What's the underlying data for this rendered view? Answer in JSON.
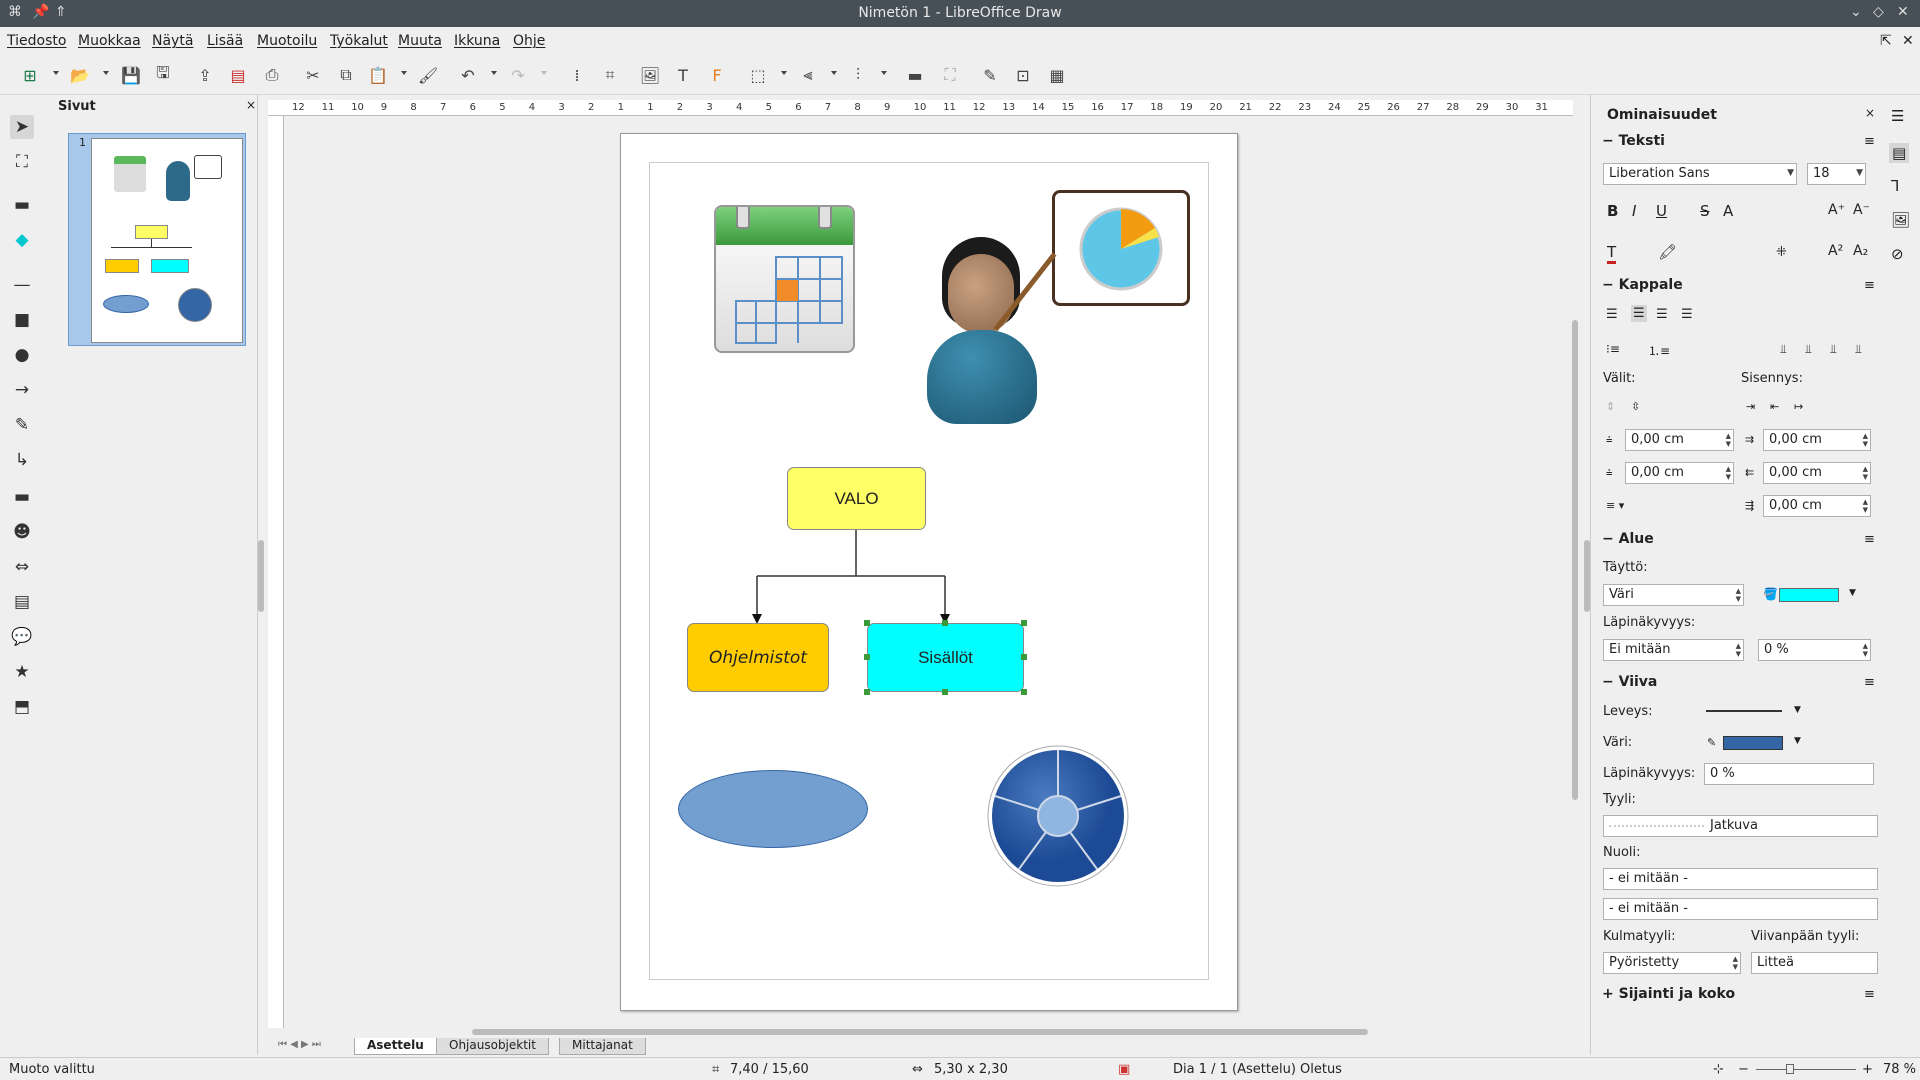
{
  "window": {
    "title": "Nimetön 1 - LibreOffice Draw"
  },
  "menu": [
    "Tiedosto",
    "Muokkaa",
    "Näytä",
    "Lisää",
    "Muotoilu",
    "Työkalut",
    "Muuta",
    "Ikkuna",
    "Ohje"
  ],
  "pages_panel": {
    "title": "Sivut",
    "page_number": "1"
  },
  "canvas": {
    "valo": "VALO",
    "ohjelmistot": "Ohjelmistot",
    "sisallot": "Sisällöt"
  },
  "sidebar": {
    "title": "Ominaisuudet",
    "text_section": "Teksti",
    "font_name": "Liberation Sans",
    "font_size": "18",
    "paragraph_section": "Kappale",
    "spacing_label": "Välit:",
    "indent_label": "Sisennys:",
    "spacing_above": "0,00 cm",
    "spacing_below": "0,00 cm",
    "indent_before": "0,00 cm",
    "indent_after": "0,00 cm",
    "indent_first": "0,00 cm",
    "area_section": "Alue",
    "fill_label": "Täyttö:",
    "fill_value": "Väri",
    "transparency_label": "Läpinäkyvyys:",
    "transparency_value": "Ei mitään",
    "transparency_percent": "0 %",
    "line_section": "Viiva",
    "width_label": "Leveys:",
    "color_label": "Väri:",
    "line_transparency_label": "Läpinäkyvyys:",
    "line_transparency_value": "0 %",
    "style_label": "Tyyli:",
    "style_value": "Jatkuva",
    "arrows_label": "Nuoli:",
    "arrow_start": "- ei mitään -",
    "arrow_end": "- ei mitään -",
    "corner_label": "Kulmatyyli:",
    "corner_value": "Pyöristetty",
    "cap_label": "Viivanpään tyyli:",
    "cap_value": "Litteä",
    "position_section": "Sijainti ja koko"
  },
  "tabs": [
    "Asettelu",
    "Ohjausobjektit",
    "Mittajanat"
  ],
  "status": {
    "shape_selected": "Muoto valittu",
    "position": "7,40 / 15,60",
    "size": "5,30 x 2,30",
    "slide": "Dia 1 / 1 (Asettelu)",
    "style": "Oletus",
    "zoom": "78 %"
  },
  "ruler_labels": [
    "12",
    "11",
    "10",
    "9",
    "8",
    "7",
    "6",
    "5",
    "4",
    "3",
    "2",
    "1",
    "1",
    "2",
    "3",
    "4",
    "5",
    "6",
    "7",
    "8",
    "9",
    "10",
    "11",
    "12",
    "13",
    "14",
    "15",
    "16",
    "17",
    "18",
    "19",
    "20",
    "21",
    "22",
    "23",
    "24",
    "25",
    "26",
    "27",
    "28",
    "29",
    "30",
    "31"
  ],
  "colors": {
    "fill": "#00ffff",
    "line_color": "#3465a4",
    "valo": "#ffff66",
    "ohjelmistot": "#ffcc00"
  }
}
